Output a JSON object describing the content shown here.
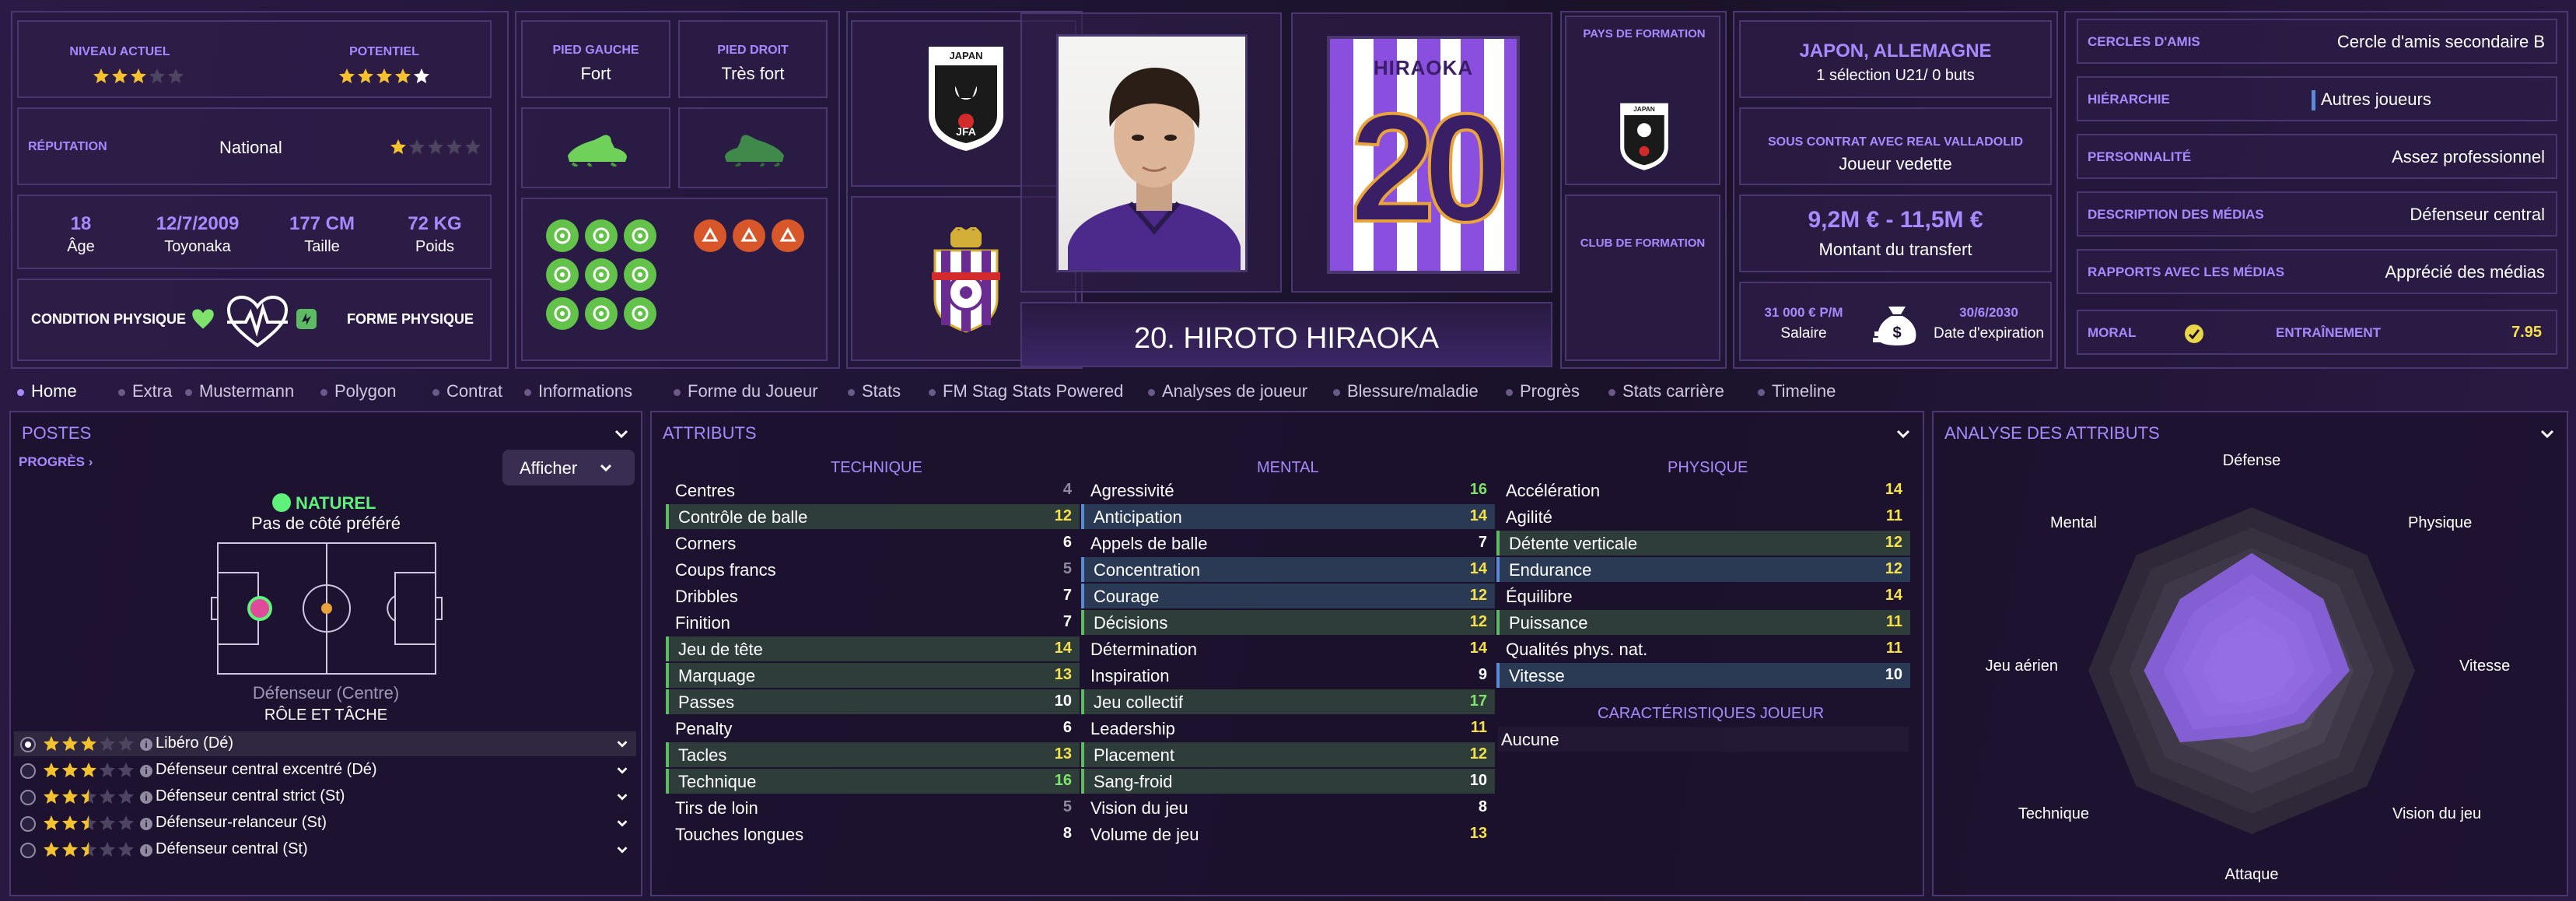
{
  "ability": {
    "current_label": "Niveau actuel",
    "potential_label": "Potentiel",
    "current_stars": 3,
    "potential_stars": 4.5
  },
  "reputation": {
    "label": "Réputation",
    "value": "National",
    "stars": 1
  },
  "bio": {
    "age_value": "18",
    "age_label": "Âge",
    "birth_value": "12/7/2009",
    "birth_label": "Toyonaka",
    "height_value": "177 CM",
    "height_label": "Taille",
    "weight_value": "72 KG",
    "weight_label": "Poids"
  },
  "condition": {
    "left_label": "Condition physique",
    "right_label": "Forme physique"
  },
  "feet": {
    "left_label": "Pied gauche",
    "left_value": "Fort",
    "right_label": "Pied droit",
    "right_value": "Très fort"
  },
  "formation": {
    "country_label": "Pays de formation",
    "club_label": "Club de formation"
  },
  "player": {
    "title": "20. HIROTO HIRAOKA",
    "shirt_name": "HIRAOKA",
    "shirt_number": "20"
  },
  "nationality": {
    "countries": "JAPON, ALLEMAGNE",
    "caps": "1 sélection U21/ 0 buts"
  },
  "contract": {
    "club_label": "Sous contrat avec Real Valladolid",
    "status": "Joueur vedette",
    "value_range": "9,2M € - 11,5M €",
    "value_label": "Montant du transfert",
    "salary": "31 000 € P/M",
    "salary_label": "Salaire",
    "expiry": "30/6/2030",
    "expiry_label": "Date d'expiration"
  },
  "right_info": [
    {
      "key": "Cercles d'amis",
      "value": "Cercle d'amis secondaire B"
    },
    {
      "key": "Hiérarchie",
      "value": "Autres joueurs"
    },
    {
      "key": "Personnalité",
      "value": "Assez professionnel"
    },
    {
      "key": "Description des médias",
      "value": "Défenseur central"
    },
    {
      "key": "Rapports avec les médias",
      "value": "Apprécié des médias"
    }
  ],
  "morale": {
    "morale_label": "Moral",
    "training_label": "Entraînement",
    "training_value": "7.95"
  },
  "tabs": [
    "Home",
    "Extra",
    "Mustermann",
    "Polygon",
    "Contrat",
    "Informations",
    "Forme du Joueur",
    "Stats",
    "FM Stag Stats Powered",
    "Analyses de joueur",
    "Blessure/maladie",
    "Progrès",
    "Stats carrière",
    "Timeline"
  ],
  "positions": {
    "title": "Postes",
    "progress_link": "PROGRÈS",
    "show_button": "Afficher",
    "natural_label": "NATUREL",
    "side_label": "Pas de côté préféré",
    "position_name": "Défenseur (Centre)",
    "role_header": "RÔLE ET TÂCHE",
    "roles": [
      {
        "name": "Libéro (Dé)",
        "stars": 3,
        "selected": true
      },
      {
        "name": "Défenseur central excentré (Dé)",
        "stars": 3,
        "selected": false
      },
      {
        "name": "Défenseur central strict (St)",
        "stars": 2.5,
        "selected": false
      },
      {
        "name": "Défenseur-relanceur (St)",
        "stars": 2.5,
        "selected": false
      },
      {
        "name": "Défenseur central (St)",
        "stars": 2.5,
        "selected": false
      }
    ]
  },
  "attributes": {
    "title": "Attributs",
    "technical_header": "TECHNIQUE",
    "mental_header": "MENTAL",
    "physical_header": "PHYSIQUE",
    "traits_header": "CARACTÉRISTIQUES JOUEUR",
    "traits_value": "Aucune",
    "technical": [
      {
        "name": "Centres",
        "value": 4,
        "hl": ""
      },
      {
        "name": "Contrôle de balle",
        "value": 12,
        "hl": "green"
      },
      {
        "name": "Corners",
        "value": 6,
        "hl": ""
      },
      {
        "name": "Coups francs",
        "value": 5,
        "hl": ""
      },
      {
        "name": "Dribbles",
        "value": 7,
        "hl": ""
      },
      {
        "name": "Finition",
        "value": 7,
        "hl": ""
      },
      {
        "name": "Jeu de tête",
        "value": 14,
        "hl": "green"
      },
      {
        "name": "Marquage",
        "value": 13,
        "hl": "green"
      },
      {
        "name": "Passes",
        "value": 10,
        "hl": "green"
      },
      {
        "name": "Penalty",
        "value": 6,
        "hl": ""
      },
      {
        "name": "Tacles",
        "value": 13,
        "hl": "green"
      },
      {
        "name": "Technique",
        "value": 16,
        "hl": "green"
      },
      {
        "name": "Tirs de loin",
        "value": 5,
        "hl": ""
      },
      {
        "name": "Touches longues",
        "value": 8,
        "hl": ""
      }
    ],
    "mental": [
      {
        "name": "Agressivité",
        "value": 16,
        "hl": ""
      },
      {
        "name": "Anticipation",
        "value": 14,
        "hl": "blue"
      },
      {
        "name": "Appels de balle",
        "value": 7,
        "hl": ""
      },
      {
        "name": "Concentration",
        "value": 14,
        "hl": "blue"
      },
      {
        "name": "Courage",
        "value": 12,
        "hl": "blue"
      },
      {
        "name": "Décisions",
        "value": 12,
        "hl": "green"
      },
      {
        "name": "Détermination",
        "value": 14,
        "hl": ""
      },
      {
        "name": "Inspiration",
        "value": 9,
        "hl": ""
      },
      {
        "name": "Jeu collectif",
        "value": 17,
        "hl": "green"
      },
      {
        "name": "Leadership",
        "value": 11,
        "hl": ""
      },
      {
        "name": "Placement",
        "value": 12,
        "hl": "green"
      },
      {
        "name": "Sang-froid",
        "value": 10,
        "hl": "green"
      },
      {
        "name": "Vision du jeu",
        "value": 8,
        "hl": ""
      },
      {
        "name": "Volume de jeu",
        "value": 13,
        "hl": ""
      }
    ],
    "physical": [
      {
        "name": "Accélération",
        "value": 14,
        "hl": ""
      },
      {
        "name": "Agilité",
        "value": 11,
        "hl": ""
      },
      {
        "name": "Détente verticale",
        "value": 12,
        "hl": "green"
      },
      {
        "name": "Endurance",
        "value": 12,
        "hl": "blue"
      },
      {
        "name": "Équilibre",
        "value": 14,
        "hl": ""
      },
      {
        "name": "Puissance",
        "value": 11,
        "hl": "green"
      },
      {
        "name": "Qualités phys. nat.",
        "value": 11,
        "hl": ""
      },
      {
        "name": "Vitesse",
        "value": 10,
        "hl": "blue"
      }
    ]
  },
  "analysis": {
    "title": "Analyse des attributs",
    "axes": [
      "Défense",
      "Physique",
      "Vitesse",
      "Vision du jeu",
      "Attaque",
      "Technique",
      "Jeu aérien",
      "Mental"
    ],
    "values": [
      0.72,
      0.62,
      0.6,
      0.45,
      0.4,
      0.62,
      0.66,
      0.62
    ]
  },
  "colors": {
    "accent": "#a58bff",
    "bg": "#1c1230",
    "border": "#4a3670",
    "green": "#7fe36b",
    "yellow": "#f5e14a"
  }
}
